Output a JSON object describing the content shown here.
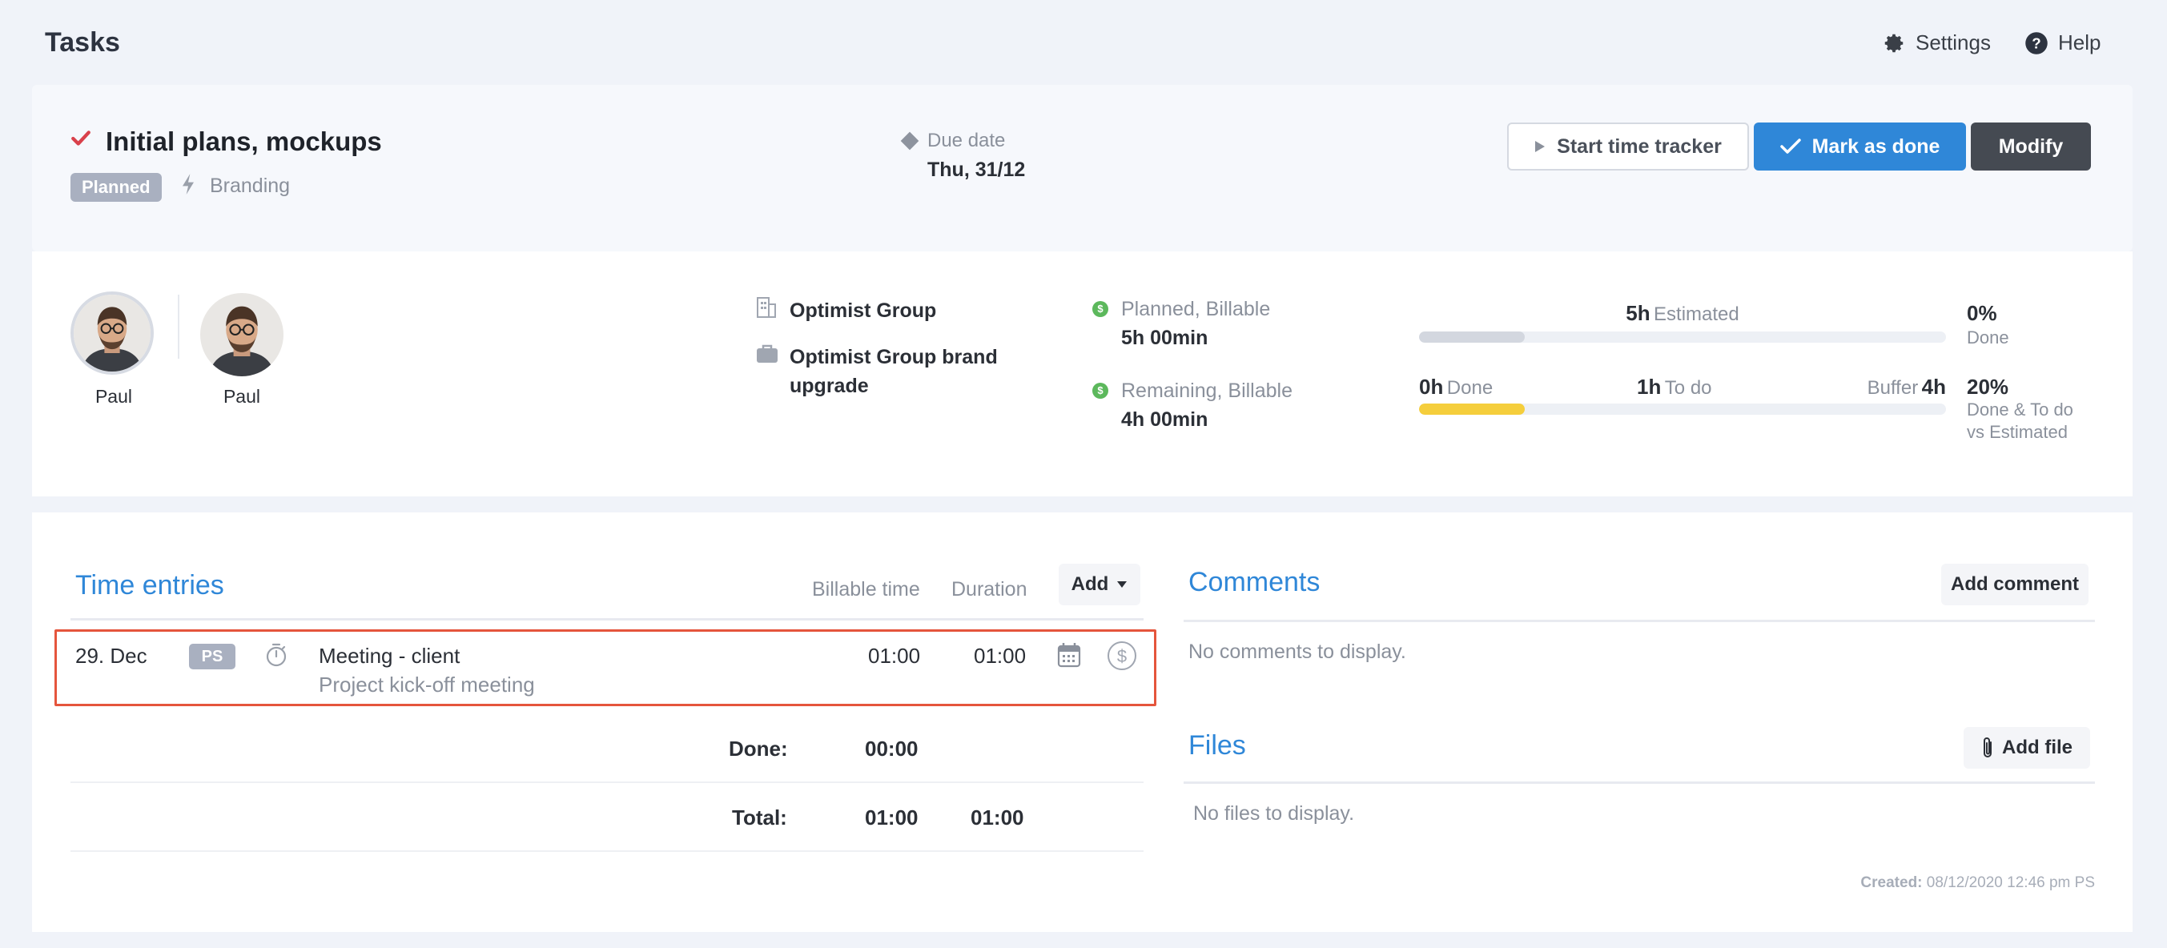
{
  "page": {
    "title": "Tasks"
  },
  "topnav": {
    "settings": "Settings",
    "help": "Help"
  },
  "task": {
    "title": "Initial plans, mockups",
    "status": "Planned",
    "tag": "Branding",
    "due_label": "Due date",
    "due_value": "Thu, 31/12"
  },
  "actions": {
    "start_tracker": "Start time tracker",
    "mark_done": "Mark as done",
    "modify": "Modify"
  },
  "assignees": [
    {
      "name": "Paul"
    },
    {
      "name": "Paul"
    }
  ],
  "client": {
    "name": "Optimist Group",
    "project": "Optimist Group brand upgrade"
  },
  "planning": {
    "planned_label": "Planned, Billable",
    "planned_value": "5h 00min",
    "remaining_label": "Remaining, Billable",
    "remaining_value": "4h 00min"
  },
  "progress": {
    "estimated_num": "5h",
    "estimated_lbl": "Estimated",
    "done_pct": "0%",
    "done_pct_lbl": "Done",
    "done_num": "0h",
    "done_lbl": "Done",
    "todo_num": "1h",
    "todo_lbl": "To do",
    "buffer_lbl": "Buffer",
    "buffer_num": "4h",
    "todo_pct": "20%",
    "todo_pct_lbl_1": "Done & To do",
    "todo_pct_lbl_2": "vs Estimated",
    "bar1_fill": 0.2,
    "bar2_fill": 0.2,
    "colors": {
      "bar1": "#d3d7df",
      "bar2": "#f5ce3c",
      "accent": "#2f87d8",
      "highlight": "#e5553c"
    }
  },
  "time_entries": {
    "title": "Time entries",
    "col_billable": "Billable time",
    "col_duration": "Duration",
    "add": "Add",
    "rows": [
      {
        "date": "29. Dec",
        "initials": "PS",
        "title": "Meeting - client",
        "note": "Project kick-off meeting",
        "billable": "01:00",
        "duration": "01:00"
      }
    ],
    "done_label": "Done:",
    "done_value": "00:00",
    "total_label": "Total:",
    "total_billable": "01:00",
    "total_duration": "01:00"
  },
  "comments": {
    "title": "Comments",
    "add": "Add comment",
    "empty": "No comments to display."
  },
  "files": {
    "title": "Files",
    "add": "Add file",
    "empty": "No files to display."
  },
  "footer": {
    "created_label": "Created:",
    "created_value": "08/12/2020 12:46 pm PS"
  }
}
